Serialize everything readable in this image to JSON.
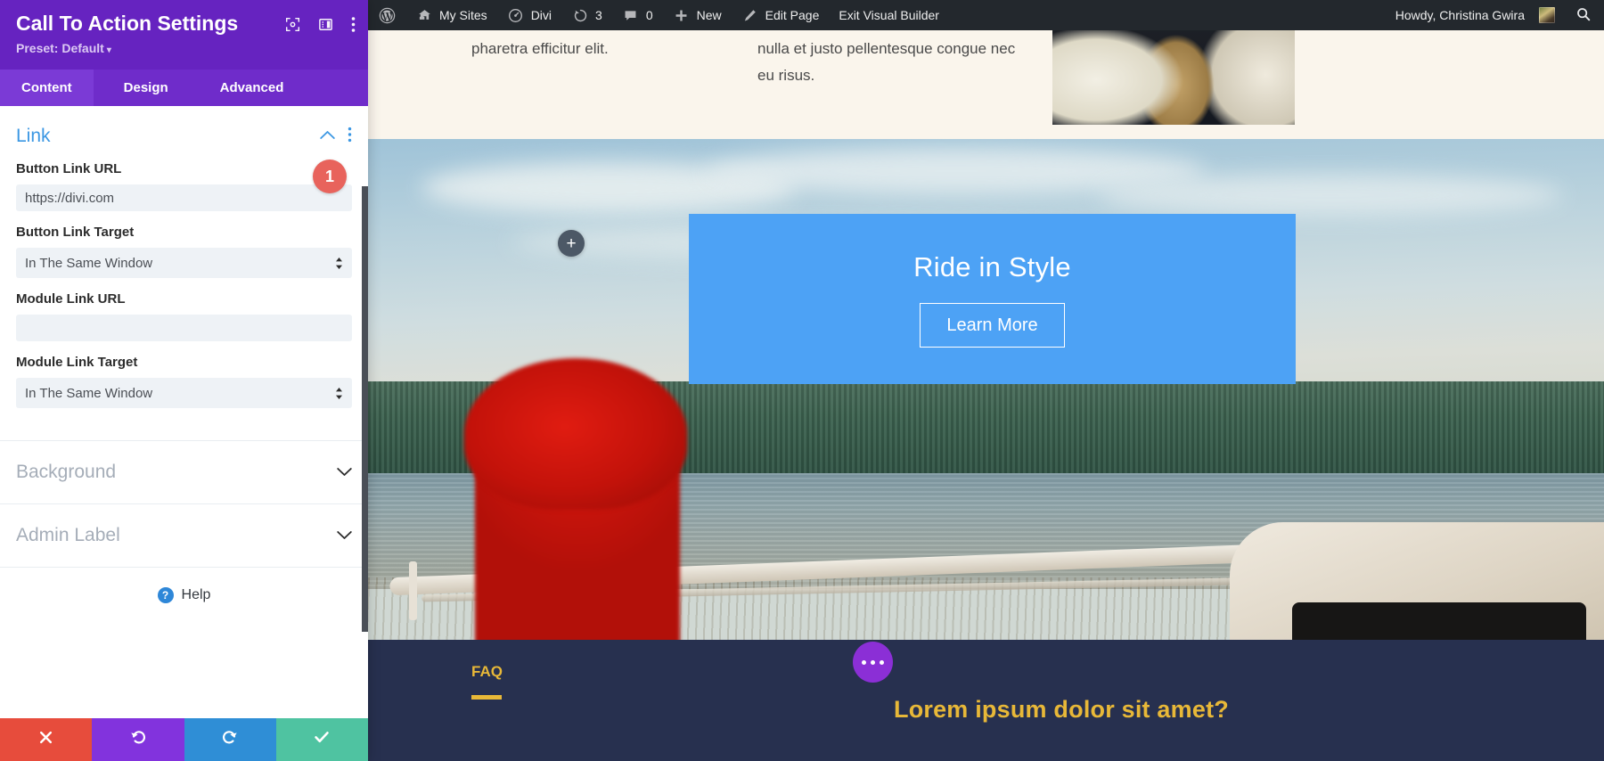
{
  "adminbar": {
    "items": [
      {
        "icon": "wordpress-logo-icon",
        "label": ""
      },
      {
        "icon": "home-icon",
        "label": "My Sites"
      },
      {
        "icon": "divi-gauge-icon",
        "label": "Divi"
      },
      {
        "icon": "updates-icon",
        "label": "3"
      },
      {
        "icon": "comments-icon",
        "label": "0"
      },
      {
        "icon": "plus-icon",
        "label": "New"
      },
      {
        "icon": "pencil-icon",
        "label": "Edit Page"
      },
      {
        "icon": "",
        "label": "Exit Visual Builder"
      }
    ],
    "howdy": "Howdy, Christina Gwira",
    "search_icon": "search-icon"
  },
  "panel": {
    "title": "Call To Action Settings",
    "preset": "Preset: Default",
    "preset_caret": "▾",
    "header_icons": [
      "focus-frame-icon",
      "layout-panel-icon",
      "kebab-menu-icon"
    ],
    "tabs": [
      {
        "label": "Content",
        "active": true
      },
      {
        "label": "Design",
        "active": false
      },
      {
        "label": "Advanced",
        "active": false
      }
    ],
    "link_section": {
      "title": "Link",
      "collapse_icon": "chevron-up-icon",
      "menu_icon": "kebab-menu-icon",
      "fields": [
        {
          "label": "Button Link URL",
          "type": "text",
          "value": "https://divi.com",
          "placeholder": "",
          "badge": "1"
        },
        {
          "label": "Button Link Target",
          "type": "select",
          "value": "In The Same Window"
        },
        {
          "label": "Module Link URL",
          "type": "text",
          "value": "",
          "placeholder": ""
        },
        {
          "label": "Module Link Target",
          "type": "select",
          "value": "In The Same Window"
        }
      ]
    },
    "collapsed_sections": [
      {
        "label": "Background",
        "icon": "chevron-down-icon"
      },
      {
        "label": "Admin Label",
        "icon": "chevron-down-icon"
      }
    ],
    "help": {
      "label": "Help",
      "icon": "question-mark-icon"
    },
    "actions": [
      {
        "name": "cancel",
        "icon": "close-x-icon",
        "glyph": "✖",
        "color": "#e74c3c"
      },
      {
        "name": "undo",
        "icon": "undo-arrow-icon",
        "glyph": "↺",
        "color": "#8233dd"
      },
      {
        "name": "redo",
        "icon": "redo-arrow-icon",
        "glyph": "↻",
        "color": "#2f8ed6"
      },
      {
        "name": "save",
        "icon": "check-icon",
        "glyph": "✔",
        "color": "#4fc3a1"
      }
    ],
    "accent_purple": "#6623c0"
  },
  "content": {
    "paragraph_left": "pharetra efficitur elit.",
    "paragraph_right": "nulla et justo pellentesque congue nec eu risus.",
    "add_module_icon": "plus-icon",
    "cta": {
      "title": "Ride in Style",
      "button_label": "Learn More",
      "background_color": "#4da2f5"
    },
    "faq": {
      "label": "FAQ",
      "question": "Lorem ipsum dolor sit amet?",
      "dots_icon": "ellipsis-icon",
      "accent_color": "#e8b838",
      "background_color": "#27304f"
    }
  }
}
